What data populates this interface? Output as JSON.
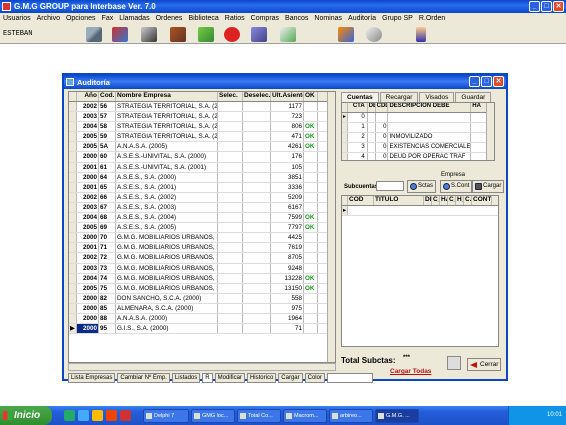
{
  "app": {
    "title": "G.M.G GROUP para Interbase Ver. 7.0",
    "window_controls": [
      "_",
      "□",
      "✕"
    ]
  },
  "menu": [
    "Usuarios",
    "Archivo",
    "Opciones",
    "Fax",
    "Llamadas",
    "Ordenes",
    "Biblioteca",
    "Ratios",
    "Compras",
    "Bancos",
    "Nominas",
    "Auditoría",
    "Grupo SP",
    "R.Orden"
  ],
  "toolbar": {
    "user": "ESTEBAN",
    "icons": [
      "truck-icon",
      "tools-icon",
      "chart-icon",
      "book-icon",
      "home-icon",
      "c-icon",
      "document-icon",
      "save-icon",
      "puzzle-icon",
      "settings-icon",
      "person-icon"
    ]
  },
  "window": {
    "title": "Auditoría",
    "controls": [
      "_",
      "□",
      "✕"
    ],
    "left_grid": {
      "headers": [
        "Año",
        "Cod.",
        "Nombre Empresa",
        "Selec.",
        "Deselec.",
        "Ult.Asiento",
        "OK"
      ],
      "rows": [
        {
          "year": "2002",
          "code": "56",
          "name": "STRATEGIA TERRITORIAL, S.A. (2002)",
          "last": "1177",
          "ok": ""
        },
        {
          "year": "2003",
          "code": "57",
          "name": "STRATEGIA TERRITORIAL, S.A. (2003)",
          "last": "723",
          "ok": ""
        },
        {
          "year": "2004",
          "code": "58",
          "name": "STRATEGIA TERRITORIAL, S.A. (2004)",
          "last": "806",
          "ok": "OK"
        },
        {
          "year": "2005",
          "code": "59",
          "name": "STRATEGIA TERRITORIAL, S.A. (2005)",
          "last": "471",
          "ok": "OK"
        },
        {
          "year": "2005",
          "code": "5A",
          "name": "A.N.A.S.A. (2005)",
          "last": "4261",
          "ok": "OK"
        },
        {
          "year": "2000",
          "code": "60",
          "name": "A.S.E.S.-UNIVITAL, S.A. (2000)",
          "last": "176",
          "ok": ""
        },
        {
          "year": "2001",
          "code": "61",
          "name": "A.S.E.S.-UNIVITAL, S.A. (2001)",
          "last": "105",
          "ok": ""
        },
        {
          "year": "2000",
          "code": "64",
          "name": "A.S.E.S., S.A. (2000)",
          "last": "3851",
          "ok": ""
        },
        {
          "year": "2001",
          "code": "65",
          "name": "A.S.E.S., S.A. (2001)",
          "last": "3336",
          "ok": ""
        },
        {
          "year": "2002",
          "code": "66",
          "name": "A.S.E.S., S.A. (2002)",
          "last": "5209",
          "ok": ""
        },
        {
          "year": "2003",
          "code": "67",
          "name": "A.S.E.S., S.A. (2003)",
          "last": "6167",
          "ok": ""
        },
        {
          "year": "2004",
          "code": "68",
          "name": "A.S.E.S., S.A. (2004)",
          "last": "7599",
          "ok": "OK"
        },
        {
          "year": "2005",
          "code": "69",
          "name": "A.S.E.S., S.A. (2005)",
          "last": "7797",
          "ok": "OK"
        },
        {
          "year": "2000",
          "code": "70",
          "name": "G.M.G. MOBILIARIOS URBANOS, S.A. (2000)",
          "last": "4425",
          "ok": ""
        },
        {
          "year": "2001",
          "code": "71",
          "name": "G.M.G. MOBILIARIOS URBANOS, S.A. (2001)",
          "last": "7619",
          "ok": ""
        },
        {
          "year": "2002",
          "code": "72",
          "name": "G.M.G. MOBILIARIOS URBANOS, S.A. (2002)",
          "last": "8705",
          "ok": ""
        },
        {
          "year": "2003",
          "code": "73",
          "name": "G.M.G. MOBILIARIOS URBANOS, S.A. (2003)",
          "last": "9248",
          "ok": ""
        },
        {
          "year": "2004",
          "code": "74",
          "name": "G.M.G. MOBILIARIOS URBANOS, S.A. (2004)",
          "last": "13228",
          "ok": "OK"
        },
        {
          "year": "2005",
          "code": "75",
          "name": "G.M.G. MOBILIARIOS URBANOS, S.A. (2005)",
          "last": "13150",
          "ok": "OK"
        },
        {
          "year": "2000",
          "code": "82",
          "name": "DON SANCHO, S.C.A. (2000)",
          "last": "558",
          "ok": ""
        },
        {
          "year": "2000",
          "code": "85",
          "name": "ALMENARA, S.C.A. (2000)",
          "last": "975",
          "ok": ""
        },
        {
          "year": "2000",
          "code": "88",
          "name": "A.N.A.S.A. (2000)",
          "last": "1964",
          "ok": ""
        },
        {
          "year": "2000",
          "code": "95",
          "name": "G.I.S., S.A. (2000)",
          "last": "71",
          "ok": ""
        }
      ]
    },
    "bottom_buttons": [
      "Lista Empresas",
      "Cambiar Nº Emp.",
      "Listados",
      "R",
      "Modificar",
      "Historico",
      "Cargar",
      "Color"
    ],
    "tabs": [
      "Cuentas",
      "Recargar",
      "Visados",
      "Guardar"
    ],
    "cuentas_grid": {
      "headers": [
        "CTA",
        "DE",
        "CDD",
        "DESCRIPCION DEBE",
        "HA"
      ],
      "rows": [
        {
          "cta": "0",
          "de": "",
          "cdd": "",
          "desc": ""
        },
        {
          "cta": "1",
          "de": "",
          "cdd": "0",
          "desc": ""
        },
        {
          "cta": "2",
          "de": "",
          "cdd": "0",
          "desc": "INMOVILIZADO"
        },
        {
          "cta": "3",
          "de": "",
          "cdd": "0",
          "desc": "EXISTENCIAS COMERCIALE"
        },
        {
          "cta": "4",
          "de": "",
          "cdd": "0",
          "desc": "DEUD POR OPERAC TRAF"
        }
      ]
    },
    "empresa_label": "Empresa",
    "subcuentas_label": "Subcuentas",
    "subc_buttons": [
      "Sctas",
      "S.Cont",
      "Cargar"
    ],
    "subcuentas_grid": {
      "headers": [
        "COD",
        "TITULO",
        "DE",
        "C_",
        "HA",
        "C_",
        "H_",
        "C.Fe",
        "CONT"
      ]
    },
    "total_label": "Total Subctas:",
    "total_value": "***",
    "cargar_todas": "Cargar Todas",
    "cerrar": "Cerrar"
  },
  "taskbar": {
    "start": "Inicio",
    "tasks": [
      "Delphi 7",
      "GMG loc...",
      "Total Co...",
      "Macrom...",
      "arbireo...",
      "G.M.G. ..."
    ],
    "clock": "10:01"
  }
}
